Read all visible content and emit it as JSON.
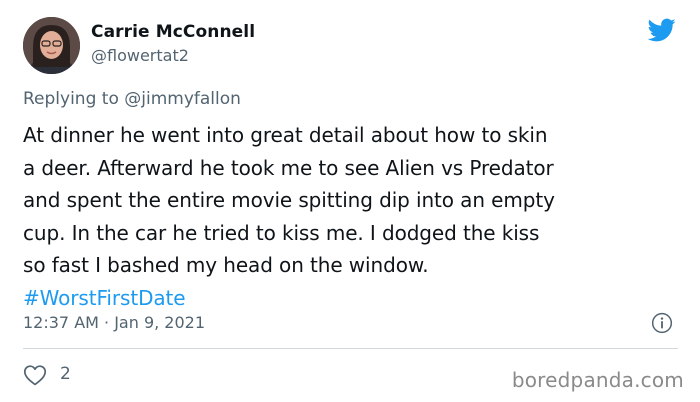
{
  "author": {
    "display_name": "Carrie McConnell",
    "handle": "@flowertat2"
  },
  "reply": {
    "prefix": "Replying to ",
    "mention": "@jimmyfallon"
  },
  "tweet": {
    "lines": [
      "At dinner he went into great detail about how to skin",
      "a deer. Afterward he took me to see Alien vs Predator",
      "and spent the entire movie spitting dip into an empty",
      "cup. In the car he tried to kiss me. I dodged the kiss",
      "so fast I bashed my head on the window."
    ],
    "hashtag": "#WorstFirstDate"
  },
  "meta": {
    "timestamp": "12:37 AM · Jan 9, 2021"
  },
  "engagement": {
    "likes": "2"
  },
  "watermark": "boredpanda.com",
  "icons": {
    "brand": "twitter-bird-icon",
    "info": "info-icon",
    "like": "heart-icon"
  },
  "colors": {
    "twitter_blue": "#1d9bf0",
    "secondary_text": "#536471",
    "divider": "#cfd9de"
  }
}
